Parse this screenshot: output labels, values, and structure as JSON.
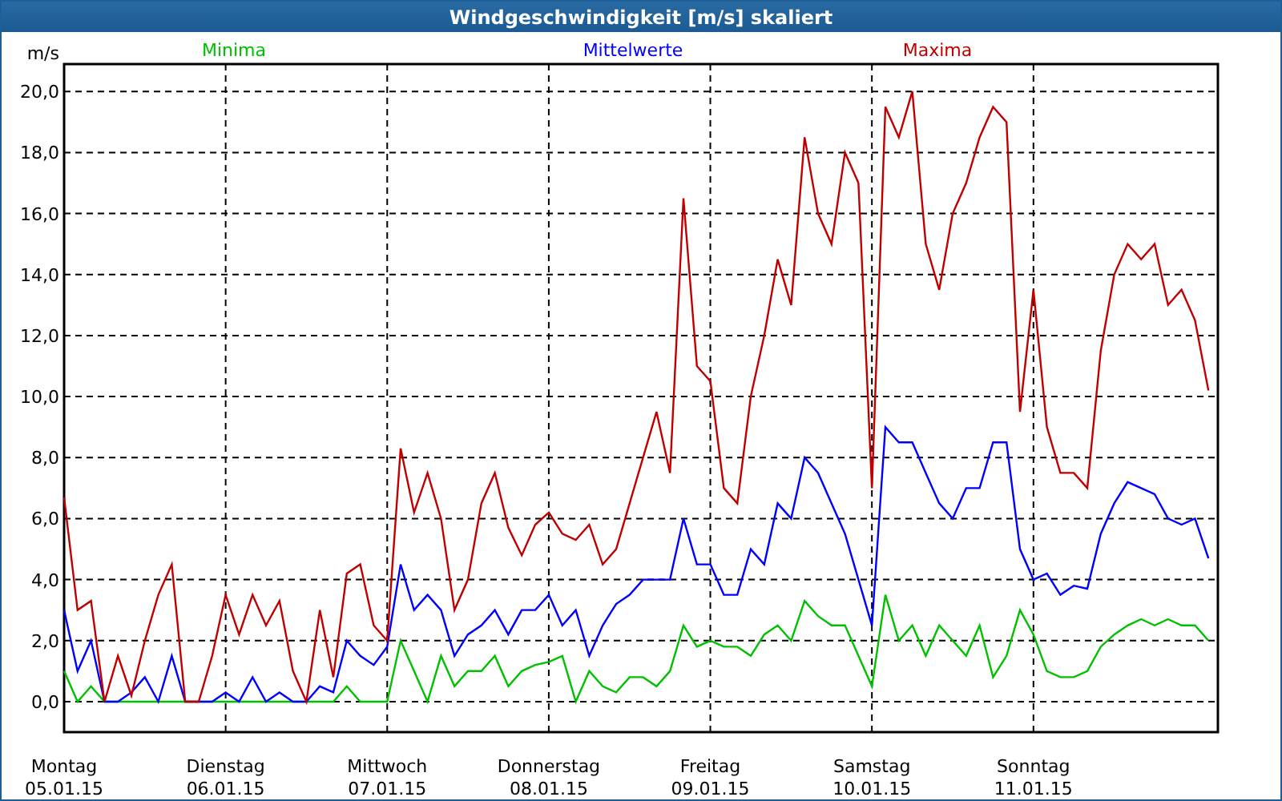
{
  "window": {
    "title": "Windgeschwindigkeit [m/s] skaliert"
  },
  "chart": {
    "dates": [
      "05.01.15",
      "06.01.15",
      "07.01.15",
      "08.01.15",
      "09.01.15",
      "10.01.15",
      "11.01.15"
    ],
    "chart_data": {
      "type": "line",
      "grid": true,
      "ylabel": "m/s",
      "ylim": [
        -1,
        20.9
      ],
      "yticks": [
        {
          "value": 0,
          "label": "0,0"
        },
        {
          "value": 2,
          "label": "2,0"
        },
        {
          "value": 4,
          "label": "4,0"
        },
        {
          "value": 6,
          "label": "6,0"
        },
        {
          "value": 8,
          "label": "8,0"
        },
        {
          "value": 10,
          "label": "10,0"
        },
        {
          "value": 12,
          "label": "12,0"
        },
        {
          "value": 14,
          "label": "14,0"
        },
        {
          "value": 16,
          "label": "16,0"
        },
        {
          "value": 18,
          "label": "18,0"
        },
        {
          "value": 20,
          "label": "20,0"
        }
      ],
      "categories": [
        "Montag",
        null,
        null,
        null,
        null,
        null,
        null,
        null,
        null,
        null,
        null,
        null,
        "Dienstag",
        null,
        null,
        null,
        null,
        null,
        null,
        null,
        null,
        null,
        null,
        null,
        "Mittwoch",
        null,
        null,
        null,
        null,
        null,
        null,
        null,
        null,
        null,
        null,
        null,
        "Donnerstag",
        null,
        null,
        null,
        null,
        null,
        null,
        null,
        null,
        null,
        null,
        null,
        "Freitag",
        null,
        null,
        null,
        null,
        null,
        null,
        null,
        null,
        null,
        null,
        null,
        "Samstag",
        null,
        null,
        null,
        null,
        null,
        null,
        null,
        null,
        null,
        null,
        null,
        "Sonntag",
        null,
        null,
        null,
        null,
        null,
        null,
        null,
        null,
        null,
        null,
        null,
        null,
        null
      ],
      "series": [
        {
          "name": "Minima",
          "color": "#00c000",
          "values": [
            1.0,
            0.0,
            0.5,
            0.0,
            0.0,
            0.0,
            0.0,
            0.0,
            0.0,
            0.0,
            0.0,
            0.0,
            0.0,
            0.0,
            0.0,
            0.0,
            0.0,
            0.0,
            0.0,
            0.0,
            0.0,
            0.5,
            0.0,
            0.0,
            0.0,
            2.0,
            1.0,
            0.0,
            1.5,
            0.5,
            1.0,
            1.0,
            1.5,
            0.5,
            1.0,
            1.2,
            1.3,
            1.5,
            0.0,
            1.0,
            0.5,
            0.3,
            0.8,
            0.8,
            0.5,
            1.0,
            2.5,
            1.8,
            2.0,
            1.8,
            1.8,
            1.5,
            2.2,
            2.5,
            2.0,
            3.3,
            2.8,
            2.5,
            2.5,
            1.5,
            0.5,
            3.5,
            2.0,
            2.5,
            1.5,
            2.5,
            2.0,
            1.5,
            2.5,
            0.8,
            1.5,
            3.0,
            2.2,
            1.0,
            0.8,
            0.8,
            1.0,
            1.8,
            2.2,
            2.5,
            2.7,
            2.5,
            2.7,
            2.5,
            2.5,
            2.0
          ]
        },
        {
          "name": "Mittelwerte",
          "color": "#0000ff",
          "values": [
            3.0,
            1.0,
            2.0,
            0.0,
            0.0,
            0.3,
            0.8,
            0.0,
            1.5,
            0.0,
            0.0,
            0.0,
            0.3,
            0.0,
            0.8,
            0.0,
            0.3,
            0.0,
            0.0,
            0.5,
            0.3,
            2.0,
            1.5,
            1.2,
            1.8,
            4.5,
            3.0,
            3.5,
            3.0,
            1.5,
            2.2,
            2.5,
            3.0,
            2.2,
            3.0,
            3.0,
            3.5,
            2.5,
            3.0,
            1.5,
            2.5,
            3.2,
            3.5,
            4.0,
            4.0,
            4.0,
            6.0,
            4.5,
            4.5,
            3.5,
            3.5,
            5.0,
            4.5,
            6.5,
            6.0,
            8.0,
            7.5,
            6.5,
            5.5,
            4.0,
            2.5,
            9.0,
            8.5,
            8.5,
            7.5,
            6.5,
            6.0,
            7.0,
            7.0,
            8.5,
            8.5,
            5.0,
            4.0,
            4.2,
            3.5,
            3.8,
            3.7,
            5.5,
            6.5,
            7.2,
            7.0,
            6.8,
            6.0,
            5.8,
            6.0,
            4.7
          ]
        },
        {
          "name": "Maxima",
          "color": "#c00000",
          "values": [
            6.7,
            3.0,
            3.3,
            0.0,
            1.5,
            0.2,
            2.0,
            3.5,
            4.5,
            0.0,
            0.0,
            1.5,
            3.5,
            2.2,
            3.5,
            2.5,
            3.3,
            1.0,
            0.0,
            3.0,
            0.8,
            4.2,
            4.5,
            2.5,
            2.0,
            8.3,
            6.2,
            7.5,
            6.0,
            3.0,
            4.0,
            6.5,
            7.5,
            5.7,
            4.8,
            5.8,
            6.2,
            5.5,
            5.3,
            5.8,
            4.5,
            5.0,
            6.5,
            8.0,
            9.5,
            7.5,
            16.5,
            11.0,
            10.5,
            7.0,
            6.5,
            10.0,
            12.0,
            14.5,
            13.0,
            18.5,
            16.0,
            15.0,
            18.0,
            17.0,
            7.0,
            19.5,
            18.5,
            20.0,
            15.0,
            13.5,
            16.0,
            17.0,
            18.5,
            19.5,
            19.0,
            9.5,
            13.5,
            9.0,
            7.5,
            7.5,
            7.0,
            11.5,
            14.0,
            15.0,
            14.5,
            15.0,
            13.0,
            13.5,
            12.5,
            10.2
          ]
        }
      ]
    }
  }
}
